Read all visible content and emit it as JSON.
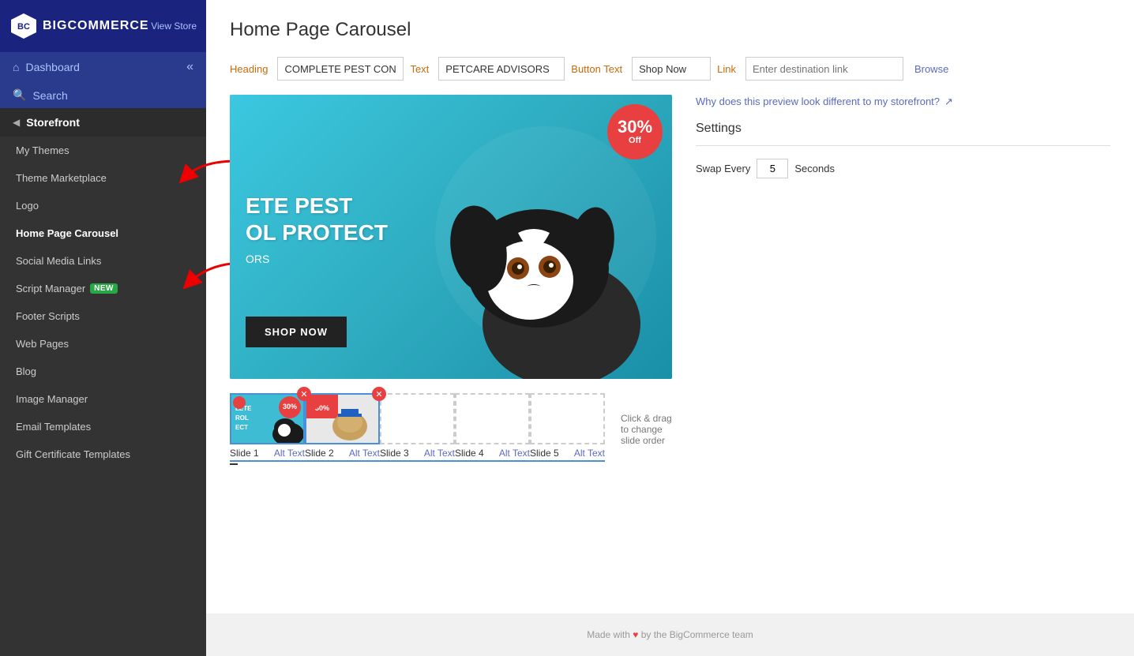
{
  "brand": {
    "name": "BIGCOMMERCE",
    "view_store": "View Store"
  },
  "sidebar": {
    "dashboard_label": "Dashboard",
    "search_label": "Search",
    "storefront_label": "Storefront",
    "nav_items": [
      {
        "id": "my-themes",
        "label": "My Themes",
        "active": false
      },
      {
        "id": "theme-marketplace",
        "label": "Theme Marketplace",
        "active": false
      },
      {
        "id": "logo",
        "label": "Logo",
        "active": false
      },
      {
        "id": "home-page-carousel",
        "label": "Home Page Carousel",
        "active": true
      },
      {
        "id": "social-media-links",
        "label": "Social Media Links",
        "active": false
      },
      {
        "id": "script-manager",
        "label": "Script Manager",
        "active": false,
        "badge": "NEW"
      },
      {
        "id": "footer-scripts",
        "label": "Footer Scripts",
        "active": false
      },
      {
        "id": "web-pages",
        "label": "Web Pages",
        "active": false
      },
      {
        "id": "blog",
        "label": "Blog",
        "active": false
      },
      {
        "id": "image-manager",
        "label": "Image Manager",
        "active": false
      },
      {
        "id": "email-templates",
        "label": "Email Templates",
        "active": false
      },
      {
        "id": "gift-certificate-templates",
        "label": "Gift Certificate Templates",
        "active": false
      }
    ]
  },
  "page": {
    "title": "Home Page Carousel",
    "toolbar": {
      "heading_label": "Heading",
      "heading_value": "COMPLETE PEST CONTR",
      "text_label": "Text",
      "text_value": "PETCARE ADVISORS",
      "button_text_label": "Button Text",
      "button_text_value": "Shop Now",
      "link_label": "Link",
      "link_placeholder": "Enter destination link",
      "browse_label": "Browse"
    },
    "preview": {
      "discount_pct": "30%",
      "discount_off": "Off",
      "overlay_heading_line1": "ETE PEST",
      "overlay_heading_line2": "OL PROTECT",
      "overlay_subtext": "ORS",
      "shop_now_btn": "SHOP NOW"
    },
    "settings": {
      "why_link": "Why does this preview look different to my storefront?",
      "title": "Settings",
      "swap_every_label": "Swap Every",
      "swap_every_value": "5",
      "seconds_label": "Seconds"
    },
    "slides": [
      {
        "id": "slide-1",
        "label": "Slide 1",
        "alt_text": "Alt Text",
        "filled": true,
        "has_delete": true
      },
      {
        "id": "slide-2",
        "label": "Slide 2",
        "alt_text": "Alt Text",
        "filled": true,
        "has_delete": true
      },
      {
        "id": "slide-3",
        "label": "Slide 3",
        "alt_text": "Alt Text",
        "filled": false
      },
      {
        "id": "slide-4",
        "label": "Slide 4",
        "alt_text": "Alt Text",
        "filled": false
      },
      {
        "id": "slide-5",
        "label": "Slide 5",
        "alt_text": "Alt Text",
        "filled": false
      }
    ],
    "drag_hint": "Click & drag to change slide order"
  },
  "footer": {
    "text": "Made with",
    "suffix": "by the BigCommerce team"
  }
}
